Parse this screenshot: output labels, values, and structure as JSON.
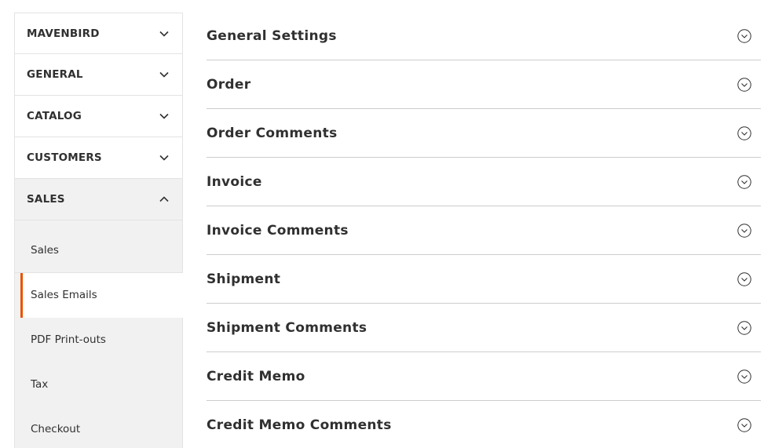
{
  "sidebar": {
    "groups": [
      {
        "label": "MAVENBIRD",
        "state": "collapsed"
      },
      {
        "label": "GENERAL",
        "state": "collapsed"
      },
      {
        "label": "CATALOG",
        "state": "collapsed"
      },
      {
        "label": "CUSTOMERS",
        "state": "collapsed"
      },
      {
        "label": "SALES",
        "state": "expanded"
      }
    ],
    "sales_items": [
      {
        "label": "Sales"
      },
      {
        "label": "Sales Emails",
        "active": true
      },
      {
        "label": "PDF Print-outs"
      },
      {
        "label": "Tax"
      },
      {
        "label": "Checkout"
      }
    ]
  },
  "main": {
    "sections": [
      {
        "title": "General Settings"
      },
      {
        "title": "Order"
      },
      {
        "title": "Order Comments"
      },
      {
        "title": "Invoice"
      },
      {
        "title": "Invoice Comments"
      },
      {
        "title": "Shipment"
      },
      {
        "title": "Shipment Comments"
      },
      {
        "title": "Credit Memo"
      },
      {
        "title": "Credit Memo Comments"
      }
    ]
  },
  "colors": {
    "accent": "#eb5202",
    "submenu_bg": "#f1f1f1",
    "border": "#e3e3e3",
    "text": "#303030"
  },
  "icons": {
    "collapsed": "chevron-down-icon",
    "expanded": "chevron-up-icon",
    "section_toggle": "circle-chevron-down-icon"
  }
}
